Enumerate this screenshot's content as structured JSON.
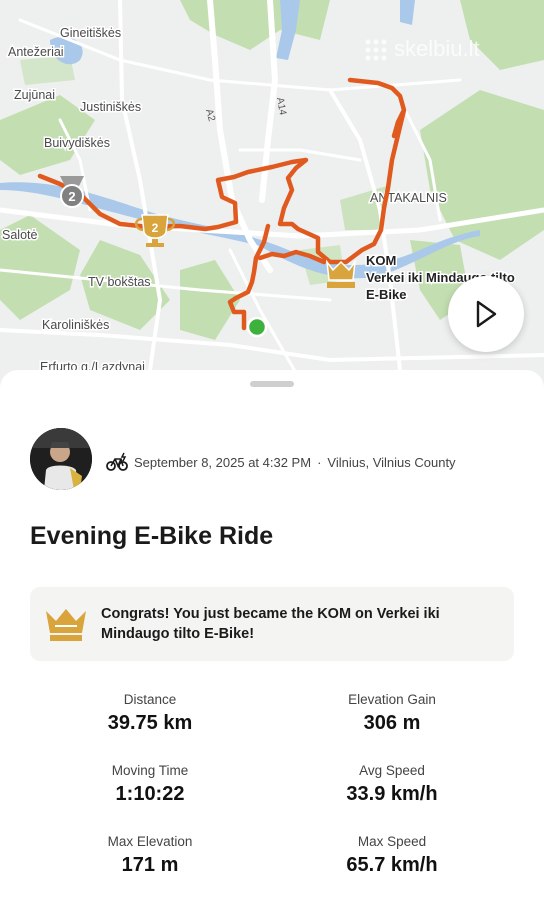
{
  "map": {
    "watermark": "skelbiu.lt",
    "labels": [
      {
        "id": "gineitiskes",
        "text": "Gineitiškės"
      },
      {
        "id": "antezeriai",
        "text": "Antežeriai"
      },
      {
        "id": "zujunai",
        "text": "Zujūnai"
      },
      {
        "id": "justiniskes",
        "text": "Justiniškės"
      },
      {
        "id": "buivydiskes",
        "text": "Buivydiškės"
      },
      {
        "id": "antakalnis",
        "text": "ANTAKALNIS"
      },
      {
        "id": "salote",
        "text": "Salotė"
      },
      {
        "id": "tvbokstas",
        "text": "TV bokštas"
      },
      {
        "id": "karoliniskes",
        "text": "Karoliniškės"
      },
      {
        "id": "erfurto",
        "text": "Erfurto g./Lazdynai"
      }
    ],
    "road_a14": "A14",
    "road_a2": "A2",
    "segment": {
      "badge": "KOM",
      "line1": "Verkei iki Mindaugo tilto",
      "line2": "E-Bike"
    },
    "markers": {
      "medal_rank": "2",
      "trophy_rank": "2"
    },
    "colors": {
      "route": "#e05a1f",
      "start": "#3cb13c",
      "gold": "#d9a43b",
      "water": "#a9c8ea",
      "park": "#c3dfb1"
    }
  },
  "activity": {
    "sport_icon": "e-bike-icon",
    "datetime": "September 8, 2025 at 4:32 PM",
    "separator": "·",
    "location": "Vilnius, Vilnius County",
    "title": "Evening E-Bike Ride"
  },
  "congrats": {
    "text": "Congrats! You just became the KOM on Verkei iki Mindaugo tilto E-Bike!"
  },
  "stats": [
    {
      "label": "Distance",
      "value": "39.75 km"
    },
    {
      "label": "Elevation Gain",
      "value": "306 m"
    },
    {
      "label": "Moving Time",
      "value": "1:10:22"
    },
    {
      "label": "Avg Speed",
      "value": "33.9 km/h"
    },
    {
      "label": "Max Elevation",
      "value": "171 m"
    },
    {
      "label": "Max Speed",
      "value": "65.7 km/h"
    }
  ]
}
